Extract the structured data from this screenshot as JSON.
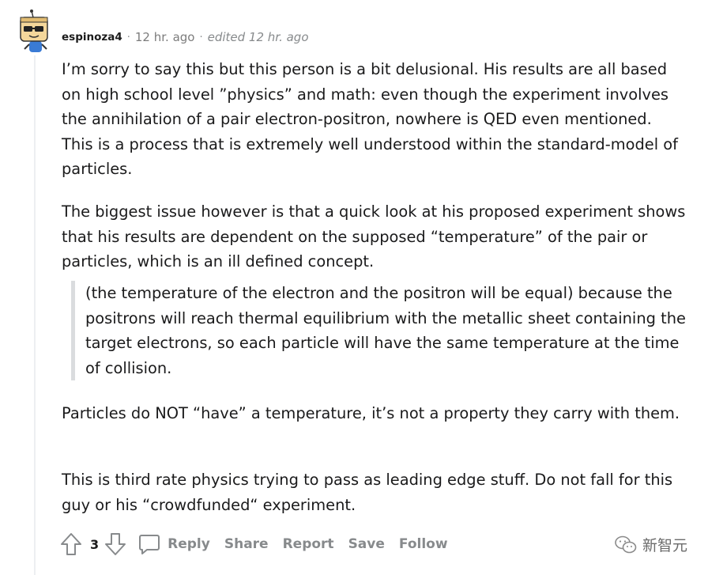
{
  "comment": {
    "author": "espinoza4",
    "separator": "·",
    "time": "12 hr. ago",
    "edited_separator": "·",
    "edited": "edited 12 hr. ago",
    "paragraphs": [
      "I’m sorry to say this but this person is a bit delusional. His results are all based on high school level ”physics” and math: even though the experiment involves the annihilation of a pair electron-positron, nowhere is QED even mentioned. This is a process that is extremely well understood within the standard-model of particles.",
      "The biggest issue however is that a quick look at his proposed experiment shows that his results are dependent on the supposed “temperature” of the pair or particles, which is an ill defined concept."
    ],
    "quote": "(the temperature of the electron and the positron will be equal) because the positrons will reach thermal equilibrium with the metallic sheet containing the target electrons, so each particle will have the same temperature at the time of collision.",
    "paragraphs_after_quote": [
      "Particles do NOT “have” a temperature, it’s not a property they carry with them.",
      "This is third rate physics trying to pass as leading edge stuff. Do not fall for this guy or his “crowdfunded“ experiment."
    ]
  },
  "actions": {
    "vote_count": "3",
    "reply": "Reply",
    "share": "Share",
    "report": "Report",
    "save": "Save",
    "follow": "Follow"
  },
  "watermark": {
    "text": "新智元"
  },
  "icons": {
    "upvote": "arrow-up-icon",
    "downvote": "arrow-down-icon",
    "reply": "speech-bubble-icon",
    "watermark": "wechat-icon",
    "avatar": "snoo-avatar-icon"
  },
  "colors": {
    "text": "#1a1a1b",
    "meta": "#878a8c",
    "quote_border": "#dadcde",
    "thread_line": "#edeff1"
  }
}
